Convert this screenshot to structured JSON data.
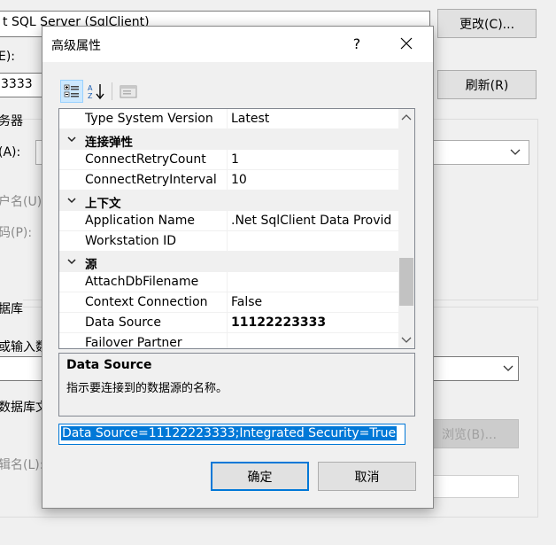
{
  "background": {
    "provider_text": "t SQL Server (SqlClient)",
    "change_button": "更改(C)...",
    "label_e": "E):",
    "server_value": "3333",
    "refresh_button": "刷新(R)",
    "server_group": "务器",
    "auth_label": "(A):",
    "username_label": "户名(U):",
    "password_label": "码(P):",
    "database_group": "据库",
    "select_db_label": "或输入数",
    "attach_db_label": "数据库文",
    "browse_button": "浏览(B)...",
    "logical_name_label": "辑名(L):"
  },
  "dialog": {
    "title": "高级属性",
    "help_glyph": "?",
    "close_glyph": "×",
    "property_rows": [
      {
        "type": "prop",
        "name": "Type System Version",
        "value": "Latest"
      },
      {
        "type": "cat",
        "name": "连接弹性"
      },
      {
        "type": "prop",
        "name": "ConnectRetryCount",
        "value": "1"
      },
      {
        "type": "prop",
        "name": "ConnectRetryInterval",
        "value": "10"
      },
      {
        "type": "cat",
        "name": "上下文"
      },
      {
        "type": "prop",
        "name": "Application Name",
        "value": ".Net SqlClient Data Provid"
      },
      {
        "type": "prop",
        "name": "Workstation ID",
        "value": ""
      },
      {
        "type": "cat",
        "name": "源"
      },
      {
        "type": "prop",
        "name": "AttachDbFilename",
        "value": ""
      },
      {
        "type": "prop",
        "name": "Context Connection",
        "value": "False"
      },
      {
        "type": "prop",
        "name": "Data Source",
        "value": "11122223333",
        "bold": true
      },
      {
        "type": "prop",
        "name": "Failover Partner",
        "value": ""
      }
    ],
    "description": {
      "title": "Data Source",
      "text": "指示要连接到的数据源的名称。"
    },
    "connection_string": "Data Source=11122223333;Integrated Security=True",
    "ok_button": "确定",
    "cancel_button": "取消"
  },
  "colors": {
    "accent": "#0078d7",
    "selection_bg": "#0078d7"
  }
}
